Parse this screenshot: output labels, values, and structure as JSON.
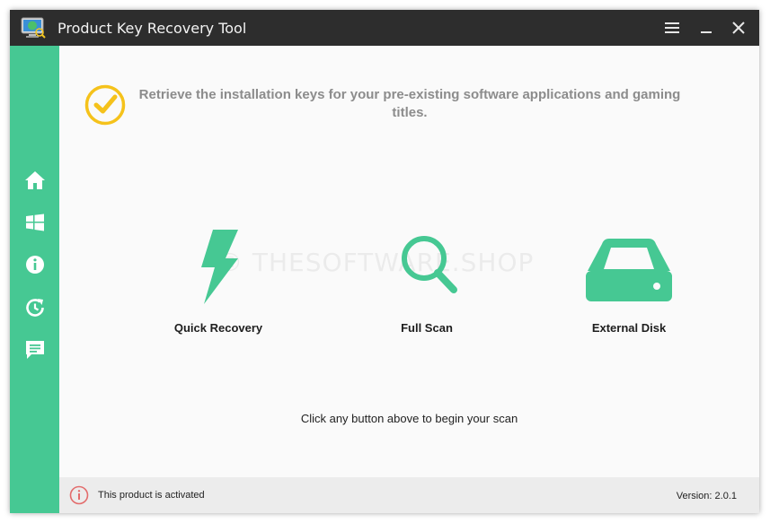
{
  "window": {
    "title": "Product Key Recovery Tool",
    "controls": {
      "menu_icon": "hamburger-icon",
      "minimize_icon": "minimize-icon",
      "close_icon": "close-icon"
    }
  },
  "sidebar": {
    "items": [
      {
        "name": "home",
        "icon": "home-icon"
      },
      {
        "name": "windows",
        "icon": "windows-icon"
      },
      {
        "name": "info",
        "icon": "info-icon"
      },
      {
        "name": "history",
        "icon": "history-icon"
      },
      {
        "name": "feedback",
        "icon": "message-icon"
      }
    ]
  },
  "main": {
    "headline": "Retrieve the installation keys for your pre-existing software applications and gaming titles.",
    "watermark": "© THESOFTWARE.SHOP",
    "actions": [
      {
        "label": "Quick Recovery",
        "icon": "lightning-icon"
      },
      {
        "label": "Full Scan",
        "icon": "magnifier-icon"
      },
      {
        "label": "External Disk",
        "icon": "disk-drive-icon"
      }
    ],
    "hint": "Click any button above to begin your scan"
  },
  "status": {
    "activation_text": "This product is activated",
    "version": "Version: 2.0.1"
  },
  "colors": {
    "accent": "#46c893",
    "titlebar": "#2d2d2d",
    "check": "#f5c21b",
    "status_icon": "#e36c6c"
  }
}
